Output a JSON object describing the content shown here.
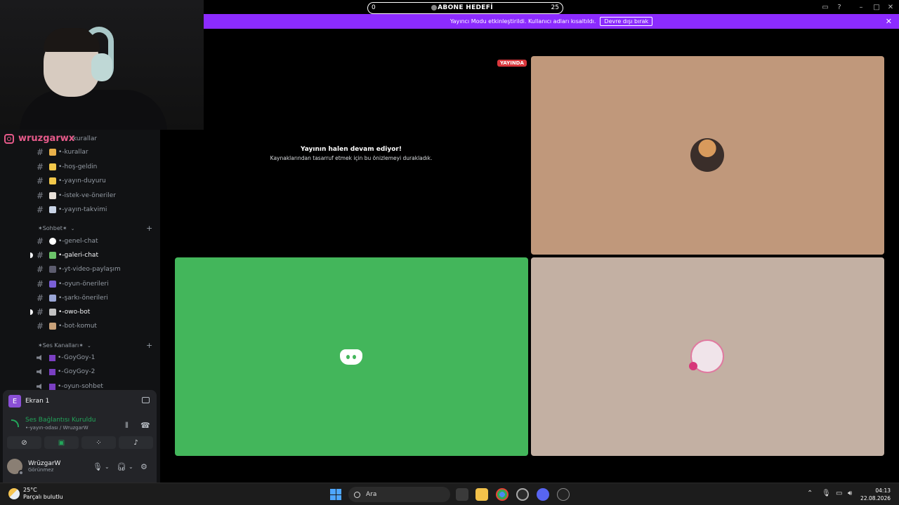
{
  "goal": {
    "left_value": "0",
    "title": "ABONE HEDEFİ",
    "right_value": "25"
  },
  "banner": {
    "text": "Yayıncı Modu etkinleştirildi. Kullanıcı adları kısaltıldı.",
    "button": "Devre dışı bırak"
  },
  "webcam": {
    "instagram": "wruzgarwx"
  },
  "sidebar": {
    "partial_top": "kurallar",
    "channels": [
      {
        "label": "•-kurallar",
        "color": "#e8b04a"
      },
      {
        "label": "•-hoş-geldin",
        "color": "#f2c84a"
      },
      {
        "label": "•-yayın-duyuru",
        "color": "#f2c84a"
      },
      {
        "label": "•-istek-ve-öneriler",
        "color": "#e8e0d8"
      },
      {
        "label": "•-yayın-takvimi",
        "color": "#c9d4e6"
      }
    ],
    "category_sohbet": "✶Sohbet✶",
    "chat_channels": [
      {
        "label": "•-genel-chat",
        "color": "#ffffff",
        "active": false
      },
      {
        "label": "•-galeri-chat",
        "color": "#6cc46a",
        "active": true
      },
      {
        "label": "•-yt-video-paylaşım",
        "color": "#5c5c6e",
        "active": false
      },
      {
        "label": "•-oyun-önerileri",
        "color": "#7a5fd6",
        "active": false
      },
      {
        "label": "•-şarkı-önerileri",
        "color": "#9aa6d6",
        "active": false
      },
      {
        "label": "•-owo-bot",
        "color": "#c2c2c2",
        "active": true
      },
      {
        "label": "•-bot-komut",
        "color": "#c9a27a",
        "active": false
      }
    ],
    "category_voice": "✶Ses Kanalları✶",
    "voice_channels": [
      {
        "label": "•-GoyGoy-1"
      },
      {
        "label": "•-GoyGoy-2"
      },
      {
        "label": "•-oyun-sohbet"
      }
    ]
  },
  "panel": {
    "screen_label": "Ekran 1",
    "screen_initial": "E",
    "connection_title": "Ses Bağlantısı Kuruldu",
    "connection_sub": "•-yayın-odası / WruzgarW",
    "username": "WrüzgarW",
    "status": "Görünmez"
  },
  "stage": {
    "live_badge": "YAYINDA",
    "paused_title": "Yayının halen devam ediyor!",
    "paused_sub": "Kaynaklarından tasarruf etmek için bu önizlemeyi durakladık."
  },
  "taskbar": {
    "temperature": "25°C",
    "weather": "Parçalı bulutlu",
    "search": "Ara",
    "time": "04:13",
    "date": "22.08.2026"
  }
}
